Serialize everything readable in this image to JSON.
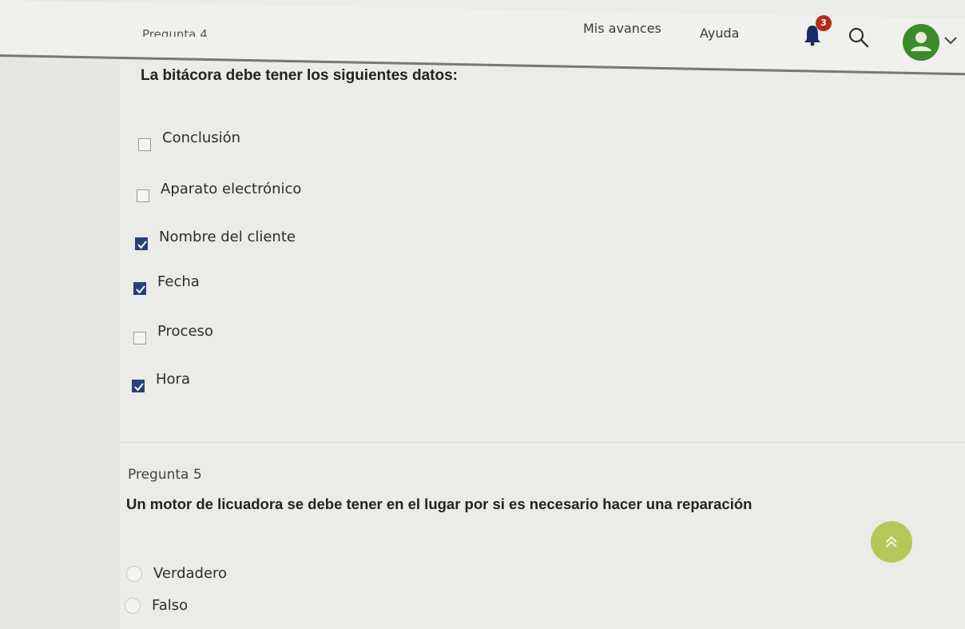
{
  "header": {
    "nav_progress": "Mis avances",
    "nav_help": "Ayuda",
    "notification_count": "3",
    "accent_color": "#3c8b2a",
    "badge_color": "#b52a1d"
  },
  "question4": {
    "label_partial": "Pregunta 4",
    "text": "La bitácora debe tener los siguientes datos:",
    "options": [
      {
        "label": "Conclusión",
        "checked": false
      },
      {
        "label": "Aparato electrónico",
        "checked": false
      },
      {
        "label": "Nombre del cliente",
        "checked": true
      },
      {
        "label": "Fecha",
        "checked": true
      },
      {
        "label": "Proceso",
        "checked": false
      },
      {
        "label": "Hora",
        "checked": true
      }
    ]
  },
  "question5": {
    "label": "Pregunta 5",
    "text": "Un motor de licuadora se debe tener en el lugar por si es necesario hacer una reparación",
    "options": [
      {
        "label": "Verdadero"
      },
      {
        "label": "Falso"
      }
    ]
  },
  "icons": {
    "bell": "bell-icon",
    "search": "search-icon",
    "avatar": "user-avatar-icon",
    "chevron": "chevron-down-icon",
    "scroll_top": "double-chevron-up-icon"
  }
}
